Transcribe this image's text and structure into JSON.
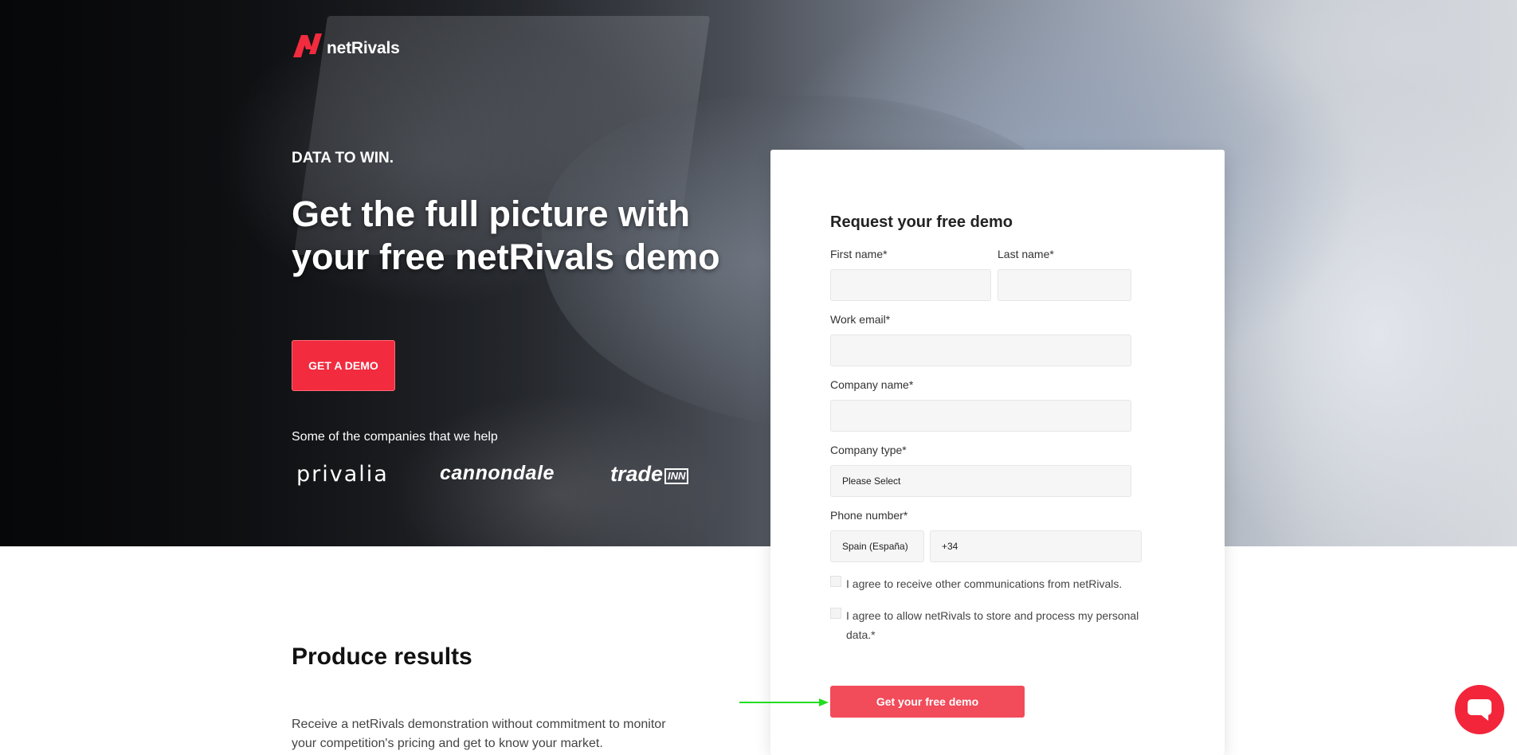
{
  "header": {
    "logo_text": "netRivals"
  },
  "hero": {
    "tagline": "DATA TO WIN.",
    "headline": "Get the full picture with your free netRivals demo",
    "cta_label": "GET A DEMO",
    "companies_label": "Some of the companies that we help",
    "brands": [
      "privalia",
      "cannondale",
      "trade",
      "INN"
    ]
  },
  "form": {
    "title": "Request your free demo",
    "first_name_label": "First name*",
    "last_name_label": "Last name*",
    "email_label": "Work email*",
    "company_label": "Company name*",
    "company_type_label": "Company type*",
    "company_type_value": "Please Select",
    "phone_label": "Phone number*",
    "phone_country": "Spain (España)",
    "phone_value": "+34",
    "consent_comms": "I agree to receive other communications from netRivals.",
    "consent_data": "I agree to allow netRivals to store and process my personal data.*",
    "submit_label": "Get your free demo"
  },
  "content": {
    "section_title": "Produce results",
    "section_body": "Receive a netRivals demonstration without commitment to monitor your competition's pricing and get to know your market."
  },
  "colors": {
    "accent": "#f22b3e",
    "submit": "#f24b5a",
    "arrow": "#22dd22"
  },
  "icons": {
    "chat": "chat-bubble-icon",
    "logo": "netrivals-n-icon"
  }
}
